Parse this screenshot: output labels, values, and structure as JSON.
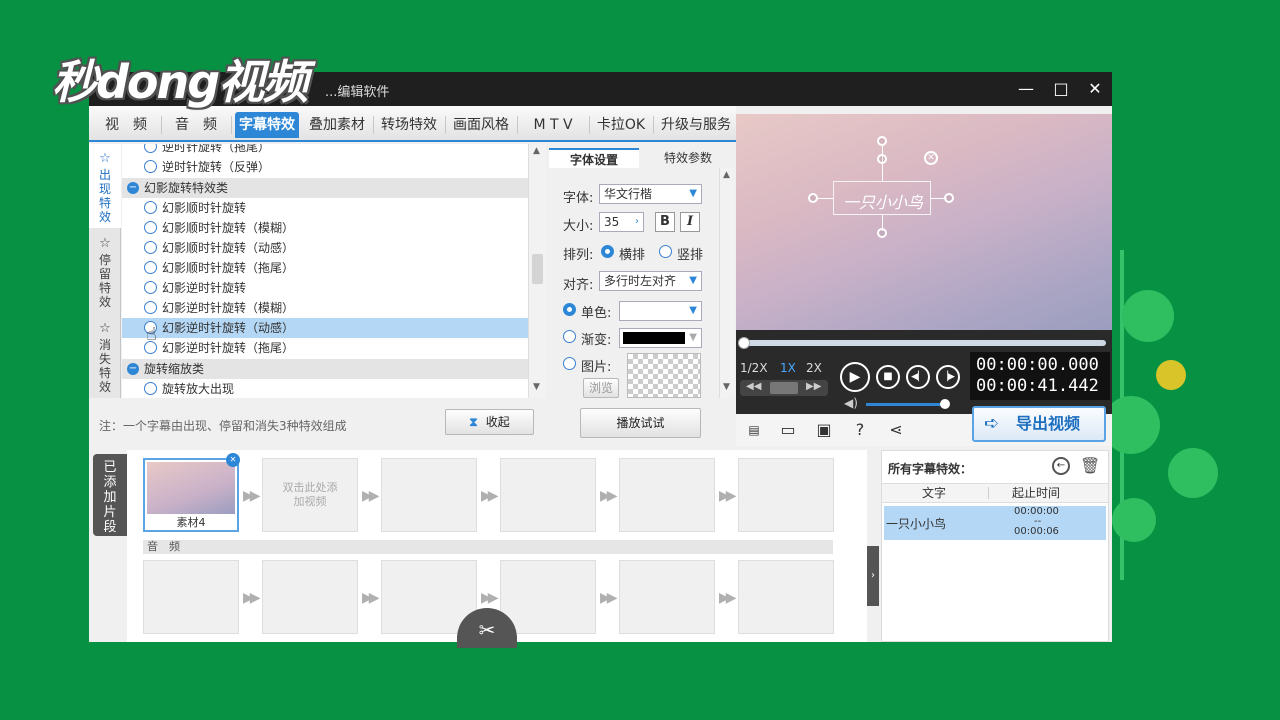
{
  "watermark": {
    "text": "秒dong视频"
  },
  "window": {
    "title": "...编辑软件",
    "controls": {
      "minimize": "—",
      "maximize": "□",
      "close": "✕"
    }
  },
  "tabs": [
    {
      "label": "视　频",
      "active": false
    },
    {
      "label": "音　频",
      "active": false
    },
    {
      "label": "字幕特效",
      "active": true
    },
    {
      "label": "叠加素材",
      "active": false
    },
    {
      "label": "转场特效",
      "active": false
    },
    {
      "label": "画面风格",
      "active": false
    },
    {
      "label": "M T V",
      "active": false
    },
    {
      "label": "卡拉OK",
      "active": false
    },
    {
      "label": "升级与服务",
      "active": false
    }
  ],
  "vtabs": [
    {
      "label": "出现特效",
      "active": true
    },
    {
      "label": "停留特效",
      "active": false
    },
    {
      "label": "消失特效",
      "active": false
    }
  ],
  "effects": [
    {
      "label": "逆时针旋转（拖尾）",
      "type": "item"
    },
    {
      "label": "逆时针旋转（反弹）",
      "type": "item"
    },
    {
      "label": "幻影旋转特效类",
      "type": "category"
    },
    {
      "label": "幻影顺时针旋转",
      "type": "item"
    },
    {
      "label": "幻影顺时针旋转（模糊）",
      "type": "item"
    },
    {
      "label": "幻影顺时针旋转（动感）",
      "type": "item"
    },
    {
      "label": "幻影顺时针旋转（拖尾）",
      "type": "item"
    },
    {
      "label": "幻影逆时针旋转",
      "type": "item"
    },
    {
      "label": "幻影逆时针旋转（模糊）",
      "type": "item"
    },
    {
      "label": "幻影逆时针旋转（动感）",
      "type": "item",
      "selected": true
    },
    {
      "label": "幻影逆时针旋转（拖尾）",
      "type": "item"
    },
    {
      "label": "旋转缩放类",
      "type": "category"
    },
    {
      "label": "旋转放大出现",
      "type": "item"
    }
  ],
  "note": "注：一个字幕由出现、停留和消失3种特效组成",
  "collapse_label": "收起",
  "font_panel": {
    "tabs": [
      "字体设置",
      "特效参数"
    ],
    "font_label": "字体:",
    "font_value": "华文行楷",
    "size_label": "大小:",
    "size_value": "35",
    "bold": "B",
    "italic": "I",
    "layout_label": "排列:",
    "layout_horizontal": "横排",
    "layout_vertical": "竖排",
    "align_label": "对齐:",
    "align_value": "多行时左对齐",
    "solid_label": "单色:",
    "gradient_label": "渐变:",
    "image_label": "图片:",
    "browse_label": "浏览"
  },
  "play_test_label": "播放试试",
  "preview": {
    "subtitle": "一只小小鸟"
  },
  "player": {
    "speeds": [
      "1/2X",
      "1X",
      "2X"
    ],
    "active_speed": "1X",
    "time_current": "00:00:00.000",
    "time_total": "00:00:41.442",
    "progress": 0,
    "volume": 0.8
  },
  "export_label": "导出视频",
  "timeline": {
    "side_label": "已添加片段",
    "clips": [
      {
        "label": "素材4",
        "filled": true
      },
      {
        "label": "双击此处添加视频",
        "filled": false
      }
    ],
    "audio_label": "音　频"
  },
  "subtitle_panel": {
    "title": "所有字幕特效：",
    "col_text": "文字",
    "col_time": "起止时间",
    "rows": [
      {
        "text": "一只小小鸟",
        "start": "00:00:00",
        "sep": "--",
        "end": "00:00:06"
      }
    ]
  }
}
